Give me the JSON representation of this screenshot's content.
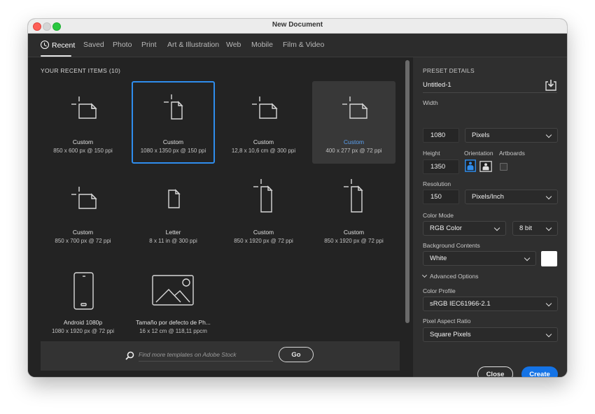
{
  "window": {
    "title": "New Document",
    "traffic_lights": [
      "close",
      "minimize",
      "maximize"
    ]
  },
  "tabs": [
    {
      "label": "Recent",
      "icon": "clock-icon",
      "active": true
    },
    {
      "label": "Saved",
      "active": false
    },
    {
      "label": "Photo",
      "active": false
    },
    {
      "label": "Print",
      "active": false
    },
    {
      "label": "Art & Illustration",
      "active": false
    },
    {
      "label": "Web",
      "active": false
    },
    {
      "label": "Mobile",
      "active": false
    },
    {
      "label": "Film & Video",
      "active": false
    }
  ],
  "recent": {
    "heading": "YOUR RECENT ITEMS",
    "count": "(10)",
    "items": [
      {
        "name": "Custom",
        "desc": "850 x 600 px @ 150 ppi",
        "icon": "custom-landscape-icon",
        "state": "normal"
      },
      {
        "name": "Custom",
        "desc": "1080 x 1350 px @ 150 ppi",
        "icon": "custom-portrait-icon",
        "state": "selected"
      },
      {
        "name": "Custom",
        "desc": "12,8 x 10,6 cm @ 300 ppi",
        "icon": "custom-landscape-icon",
        "state": "normal"
      },
      {
        "name": "Custom",
        "desc": "400 x 277 px @ 72 ppi",
        "icon": "custom-landscape-icon",
        "state": "hover"
      },
      {
        "name": "Custom",
        "desc": "850 x 700 px @ 72 ppi",
        "icon": "custom-landscape-icon",
        "state": "normal"
      },
      {
        "name": "Letter",
        "desc": "8 x 11 in @ 300 ppi",
        "icon": "document-icon",
        "state": "normal"
      },
      {
        "name": "Custom",
        "desc": "850 x 1920 px @ 72 ppi",
        "icon": "custom-tall-icon",
        "state": "normal"
      },
      {
        "name": "Custom",
        "desc": "850 x 1920 px @ 72 ppi",
        "icon": "custom-tall-icon",
        "state": "normal"
      },
      {
        "name": "Android 1080p",
        "desc": "1080 x 1920 px @ 72 ppi",
        "icon": "phone-icon",
        "state": "normal"
      },
      {
        "name": "Tamaño por defecto de Ph...",
        "desc": "16 x 12 cm @ 118,11 ppcm",
        "icon": "image-icon",
        "state": "normal"
      }
    ]
  },
  "stock": {
    "placeholder": "Find more templates on Adobe Stock",
    "go_label": "Go"
  },
  "preset": {
    "heading": "PRESET DETAILS",
    "doc_name": "Untitled-1",
    "width_label": "Width",
    "width_value": "1080",
    "width_unit": "Pixels",
    "height_label": "Height",
    "height_value": "1350",
    "orientation_label": "Orientation",
    "orientation_selected": "portrait",
    "artboards_label": "Artboards",
    "artboards_checked": false,
    "resolution_label": "Resolution",
    "resolution_value": "150",
    "resolution_unit": "Pixels/Inch",
    "color_mode_label": "Color Mode",
    "color_mode": "RGB Color",
    "bit_depth": "8 bit",
    "background_label": "Background Contents",
    "background": "White",
    "background_swatch": "#ffffff",
    "advanced_label": "Advanced Options",
    "color_profile_label": "Color Profile",
    "color_profile": "sRGB IEC61966-2.1",
    "pixel_aspect_label": "Pixel Aspect Ratio",
    "pixel_aspect": "Square Pixels",
    "close_label": "Close",
    "create_label": "Create"
  },
  "colors": {
    "accent": "#1473e6",
    "selection": "#2f8ded"
  }
}
